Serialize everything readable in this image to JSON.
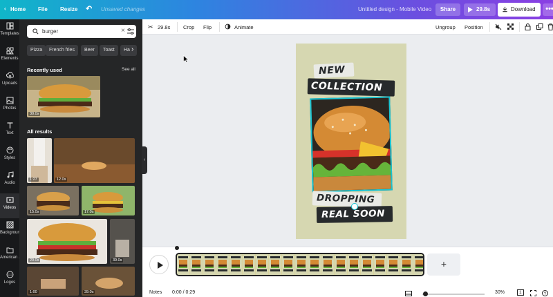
{
  "topbar": {
    "home": "Home",
    "file": "File",
    "resize": "Resize",
    "unsaved": "Unsaved changes",
    "doc_title": "Untitled design - Mobile Video",
    "share": "Share",
    "play_time": "29.8s",
    "download": "Download",
    "more": "•••"
  },
  "rail": [
    {
      "label": "Templates",
      "icon": "templates-icon"
    },
    {
      "label": "Elements",
      "icon": "elements-icon"
    },
    {
      "label": "Uploads",
      "icon": "uploads-icon"
    },
    {
      "label": "Photos",
      "icon": "photos-icon"
    },
    {
      "label": "Text",
      "icon": "text-icon"
    },
    {
      "label": "Styles",
      "icon": "styles-icon"
    },
    {
      "label": "Audio",
      "icon": "audio-icon"
    },
    {
      "label": "Videos",
      "icon": "videos-icon"
    },
    {
      "label": "Background",
      "icon": "background-icon"
    },
    {
      "label": "American ...",
      "icon": "folder-icon"
    },
    {
      "label": "Logos",
      "icon": "logos-icon"
    }
  ],
  "search": {
    "value": "burger"
  },
  "chips": [
    "Pizza",
    "French fries",
    "Beer",
    "Toast",
    "Ha"
  ],
  "panel": {
    "recent_title": "Recently used",
    "see_all": "See all",
    "all_title": "All results"
  },
  "recent": [
    {
      "dur": "30.0s"
    }
  ],
  "results": [
    {
      "dur": "1:27"
    },
    {
      "dur": "12.0s"
    },
    {
      "dur": "15.0s"
    },
    {
      "dur": "17.0s"
    },
    {
      "dur": "20.0s"
    },
    {
      "dur": "39.0s"
    },
    {
      "dur": "1:00"
    },
    {
      "dur": "39.0s"
    }
  ],
  "toolbar": {
    "trim": "29.8s",
    "crop": "Crop",
    "flip": "Flip",
    "animate": "Animate",
    "ungroup": "Ungroup",
    "position": "Position"
  },
  "design": {
    "line1": "NEW",
    "line2": "COLLECTION",
    "line3": "DROPPING",
    "line4": "REAL SOON"
  },
  "timeline": {
    "add": "+"
  },
  "footer": {
    "notes": "Notes",
    "time": "0:00 / 0:29",
    "zoom": "30%",
    "page": "1"
  },
  "colors": {
    "canvas_bg": "#d6d7b1",
    "tag_dark": "#272a2c",
    "selection": "#18c4d3",
    "panel_bg": "#252627"
  }
}
